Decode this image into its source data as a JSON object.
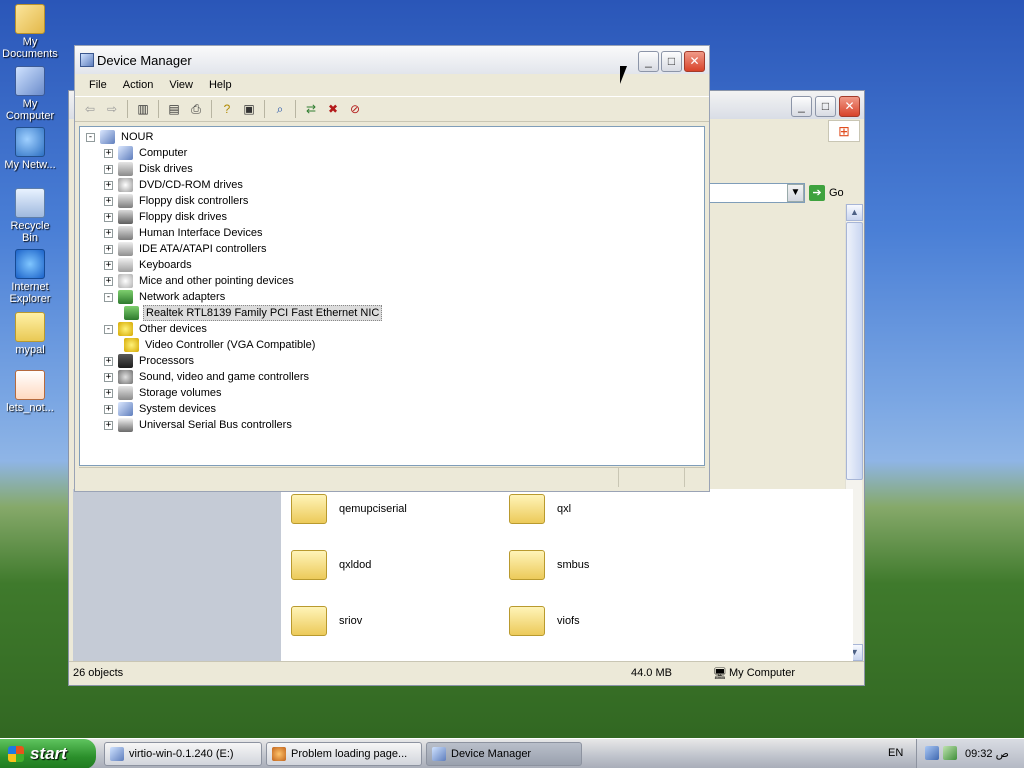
{
  "desktop_icons": [
    {
      "label": "My Documents",
      "icon": "my-documents-icon"
    },
    {
      "label": "My Computer",
      "icon": "my-computer-icon"
    },
    {
      "label": "My Netw...",
      "icon": "my-network-icon"
    },
    {
      "label": "Recycle Bin",
      "icon": "recycle-bin-icon"
    },
    {
      "label": "Internet Explorer",
      "icon": "internet-explorer-icon"
    },
    {
      "label": "mypal",
      "icon": "folder-icon"
    },
    {
      "label": "lets_not...",
      "icon": "file-icon"
    }
  ],
  "device_manager": {
    "title": "Device Manager",
    "menu": [
      "File",
      "Action",
      "View",
      "Help"
    ],
    "toolbar_icons": [
      "back-arrow-icon",
      "forward-arrow-icon",
      "console-tree-icon",
      "properties-icon",
      "print-icon",
      "help-icon",
      "export-icon",
      "scan-hardware-icon",
      "update-driver-icon",
      "uninstall-icon",
      "disable-icon"
    ],
    "tree": {
      "root": "NOUR",
      "items": [
        {
          "label": "Computer",
          "expander": "+",
          "icon": "computer-icon"
        },
        {
          "label": "Disk drives",
          "expander": "+",
          "icon": "disk-drive-icon"
        },
        {
          "label": "DVD/CD-ROM drives",
          "expander": "+",
          "icon": "cdrom-icon"
        },
        {
          "label": "Floppy disk controllers",
          "expander": "+",
          "icon": "floppy-controller-icon"
        },
        {
          "label": "Floppy disk drives",
          "expander": "+",
          "icon": "floppy-drive-icon"
        },
        {
          "label": "Human Interface Devices",
          "expander": "+",
          "icon": "hid-icon"
        },
        {
          "label": "IDE ATA/ATAPI controllers",
          "expander": "+",
          "icon": "ide-icon"
        },
        {
          "label": "Keyboards",
          "expander": "+",
          "icon": "keyboard-icon"
        },
        {
          "label": "Mice and other pointing devices",
          "expander": "+",
          "icon": "mouse-icon"
        },
        {
          "label": "Network adapters",
          "expander": "-",
          "icon": "network-adapter-icon"
        },
        {
          "label": "Realtek RTL8139 Family PCI Fast Ethernet NIC",
          "expander": "",
          "icon": "network-card-icon",
          "child": true,
          "selected": true
        },
        {
          "label": "Other devices",
          "expander": "-",
          "icon": "unknown-device-icon"
        },
        {
          "label": "Video Controller (VGA Compatible)",
          "expander": "",
          "icon": "warning-device-icon",
          "child": true
        },
        {
          "label": "Processors",
          "expander": "+",
          "icon": "processor-icon"
        },
        {
          "label": "Sound, video and game controllers",
          "expander": "+",
          "icon": "sound-icon"
        },
        {
          "label": "Storage volumes",
          "expander": "+",
          "icon": "storage-volume-icon"
        },
        {
          "label": "System devices",
          "expander": "+",
          "icon": "system-device-icon"
        },
        {
          "label": "Universal Serial Bus controllers",
          "expander": "+",
          "icon": "usb-icon"
        }
      ]
    }
  },
  "explorer": {
    "go_label": "Go",
    "folders": [
      "qemupciserial",
      "qxl",
      "qxldod",
      "smbus",
      "sriov",
      "viofs"
    ],
    "status": {
      "objects": "26 objects",
      "size": "44.0 MB",
      "location": "My Computer"
    }
  },
  "taskbar": {
    "start_label": "start",
    "tasks": [
      {
        "label": "virtio-win-0.1.240 (E:)",
        "active": false
      },
      {
        "label": "Problem loading page...",
        "active": false
      },
      {
        "label": "Device Manager",
        "active": true
      }
    ],
    "language": "EN",
    "clock": "09:32 ص"
  }
}
